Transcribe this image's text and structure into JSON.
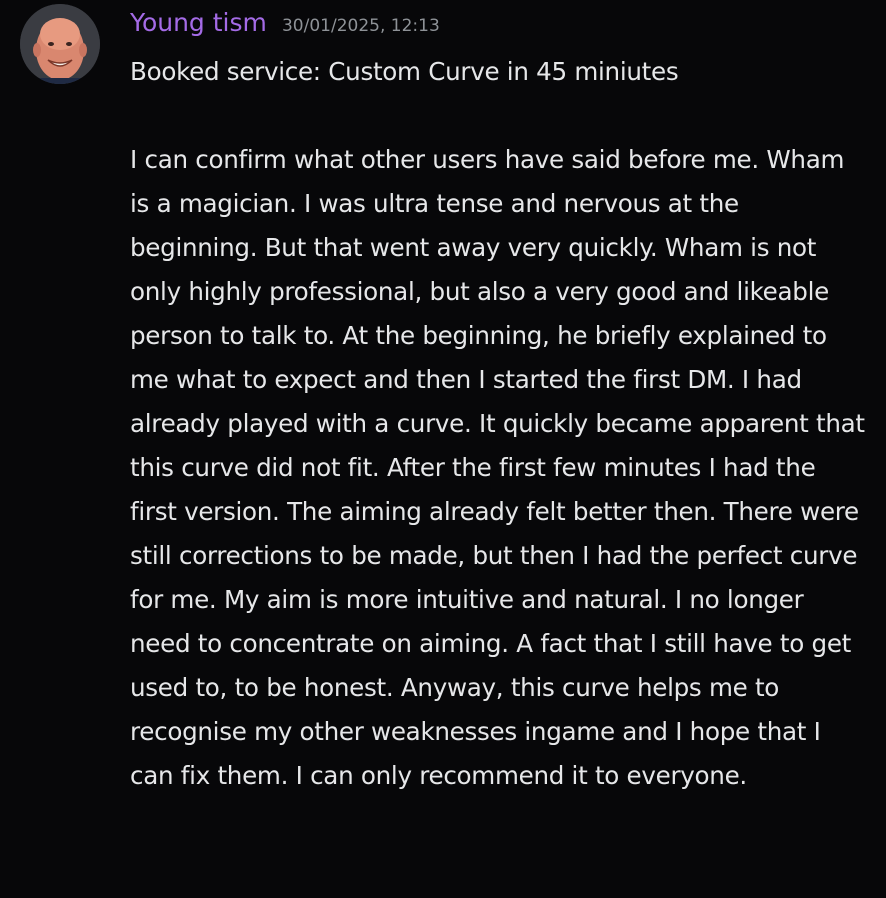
{
  "message": {
    "username": "Young tism",
    "timestamp": "30/01/2025, 12:13",
    "avatar_icon": "user-avatar-photo",
    "username_color": "#a46be6",
    "line1": "Booked service: Custom Curve in 45 miniutes",
    "body": "I can confirm what other users have said before me. Wham is a magician. I was ultra tense and nervous at the beginning. But that went away very quickly. Wham is not only highly professional, but also a very good and likeable person to talk to. At the beginning, he briefly explained to me what to expect and then I started the first DM. I had already played with a curve. It quickly became apparent that this curve did not fit. After the first few minutes I had the first version. The aiming already felt better then. There were still corrections to be made, but then I had the perfect curve for me. My aim is more intuitive and natural. I no longer need to concentrate on aiming. A fact that I still have to get used to, to be honest. Anyway, this curve helps me to recognise my other weaknesses ingame and I hope that I can fix them. I can only recommend it to everyone."
  }
}
